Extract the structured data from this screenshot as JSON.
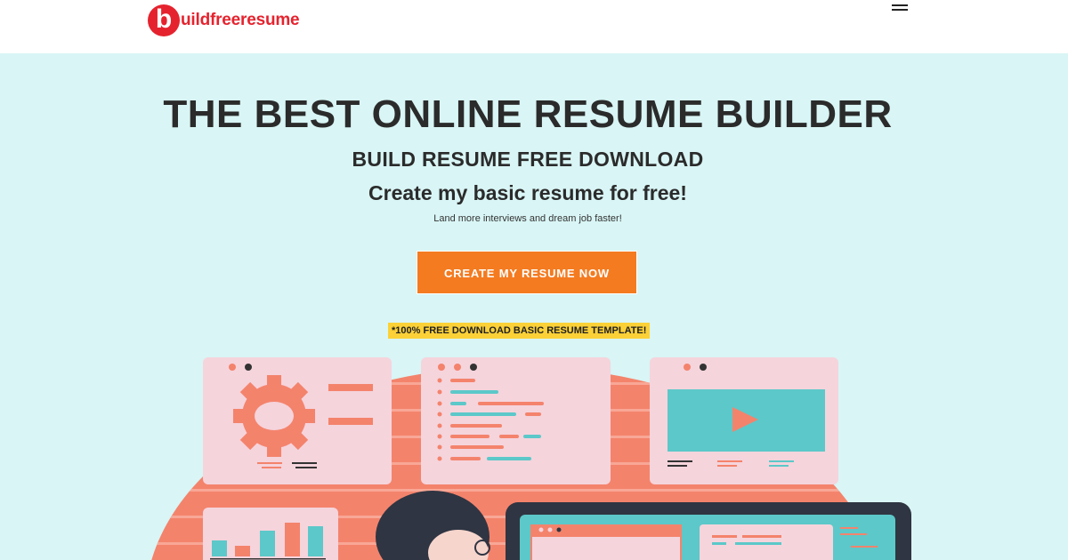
{
  "header": {
    "logo_letter": "b",
    "logo_text": "uildfreeresume",
    "menu_icon": "hamburger-menu-icon"
  },
  "hero": {
    "title": "THE BEST ONLINE RESUME BUILDER",
    "subtitle": "BUILD RESUME FREE DOWNLOAD",
    "tagline": "Create my basic resume for free!",
    "description": "Land more interviews and dream job faster!",
    "cta_label": "CREATE MY RESUME NOW",
    "note": "*100% FREE DOWNLOAD BASIC RESUME TEMPLATE!"
  },
  "colors": {
    "background": "#d9f5f5",
    "brand_red": "#e5232e",
    "cta_orange": "#f47b20",
    "note_yellow": "#fbd137",
    "illustration_coral": "#f47e66",
    "card_pink": "#f5d4dc",
    "teal": "#5cc8c9"
  }
}
